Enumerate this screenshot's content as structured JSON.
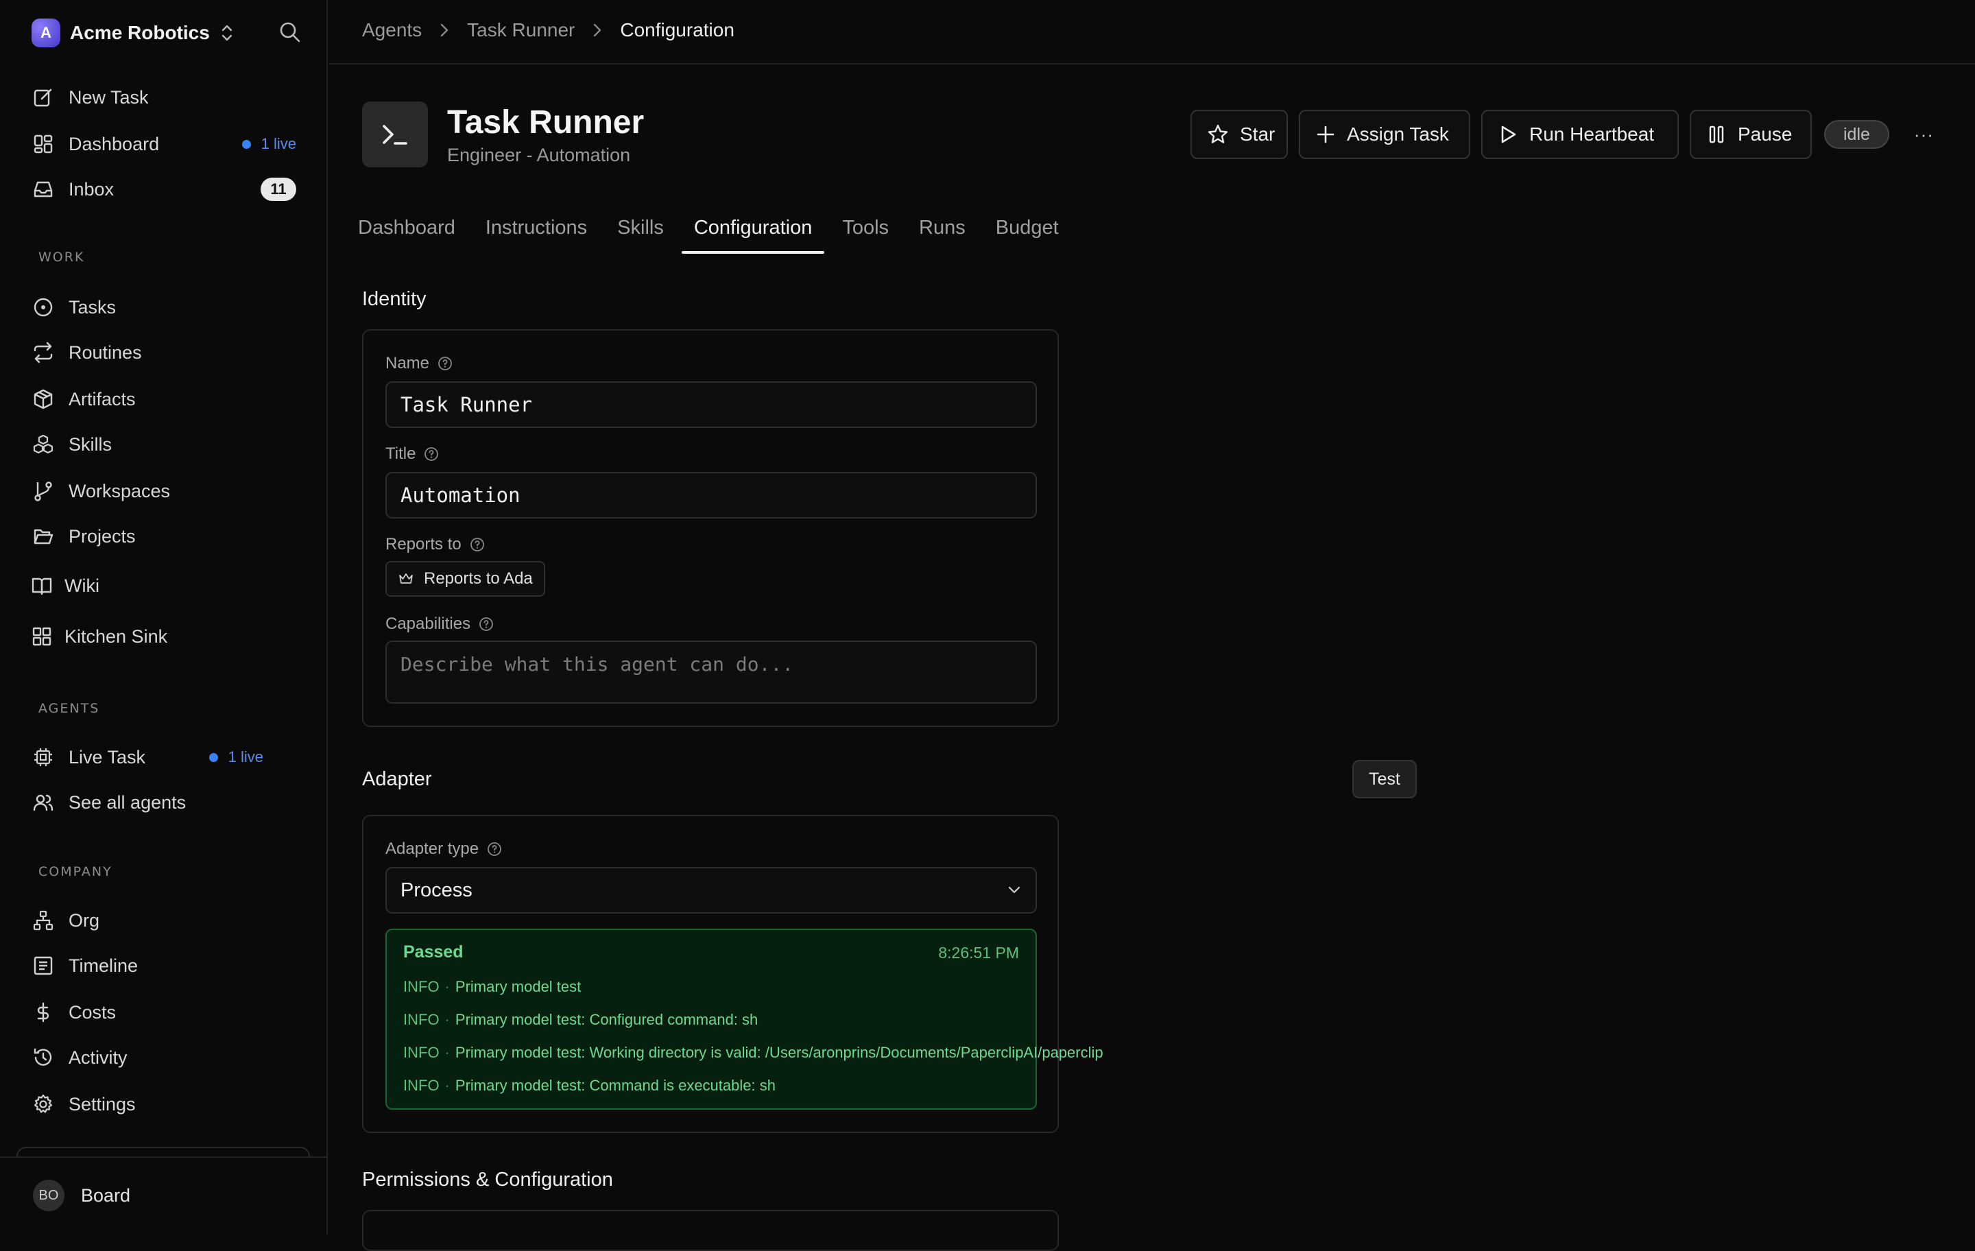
{
  "workspace": {
    "initial": "A",
    "name": "Acme Robotics"
  },
  "sidebar": {
    "top_items": [
      {
        "label": "New Task"
      },
      {
        "label": "Dashboard",
        "live": "1 live"
      },
      {
        "label": "Inbox",
        "badge": "11"
      }
    ],
    "work_label": "WORK",
    "work_items": [
      {
        "label": "Tasks"
      },
      {
        "label": "Routines"
      },
      {
        "label": "Artifacts"
      },
      {
        "label": "Skills"
      },
      {
        "label": "Workspaces"
      },
      {
        "label": "Projects"
      },
      {
        "label": "Wiki"
      },
      {
        "label": "Kitchen Sink"
      }
    ],
    "agents_label": "AGENTS",
    "agent_items": [
      {
        "label": "Live Task",
        "live": "1 live"
      },
      {
        "label": "See all agents"
      }
    ],
    "company_label": "COMPANY",
    "company_items": [
      {
        "label": "Org"
      },
      {
        "label": "Timeline"
      },
      {
        "label": "Costs"
      },
      {
        "label": "Activity"
      },
      {
        "label": "Settings"
      }
    ],
    "user": {
      "initials": "BO",
      "name": "Board"
    }
  },
  "breadcrumb": [
    "Agents",
    "Task Runner",
    "Configuration"
  ],
  "agent": {
    "name": "Task Runner",
    "role": "Engineer - Automation",
    "status": "idle"
  },
  "actions": {
    "star": "Star",
    "assign": "Assign Task",
    "heartbeat": "Run Heartbeat",
    "pause": "Pause",
    "more": "···"
  },
  "tabs": [
    "Dashboard",
    "Instructions",
    "Skills",
    "Configuration",
    "Tools",
    "Runs",
    "Budget"
  ],
  "active_tab": "Configuration",
  "identity": {
    "title": "Identity",
    "name_label": "Name",
    "name_value": "Task Runner",
    "title_label": "Title",
    "title_value": "Automation",
    "reports_label": "Reports to",
    "reports_value": "Reports to Ada",
    "capabilities_label": "Capabilities",
    "capabilities_placeholder": "Describe what this agent can do..."
  },
  "adapter": {
    "title": "Adapter",
    "test_label": "Test",
    "type_label": "Adapter type",
    "type_value": "Process",
    "result": {
      "status": "Passed",
      "time": "8:26:51 PM",
      "logs": [
        {
          "level": "INFO",
          "message": "Primary model test"
        },
        {
          "level": "INFO",
          "message": "Primary model test: Configured command: sh"
        },
        {
          "level": "INFO",
          "message": "Primary model test: Working directory is valid: /Users/aronprins/Documents/PaperclipAI/paperclip"
        },
        {
          "level": "INFO",
          "message": "Primary model test: Command is executable: sh"
        }
      ]
    }
  },
  "permissions": {
    "title": "Permissions & Configuration"
  },
  "colors": {
    "live_blue": "#3b82f6",
    "success_green": "#6fd98f",
    "success_border": "#166534"
  }
}
